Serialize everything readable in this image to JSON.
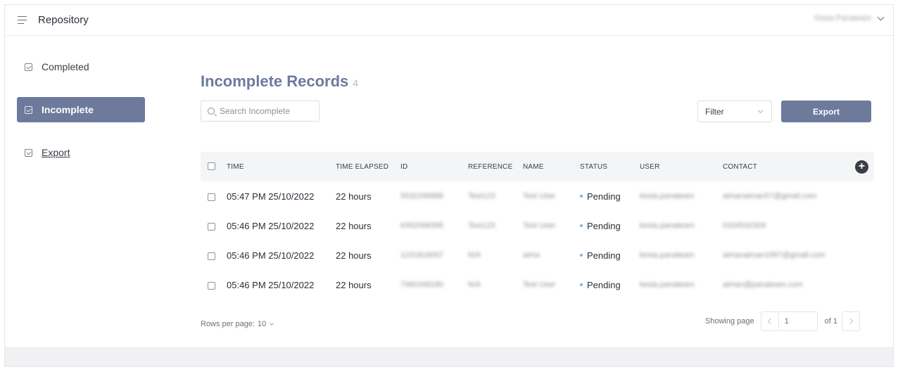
{
  "topbar": {
    "title": "Repository",
    "user_name": "Kesia Panateam"
  },
  "sidebar": {
    "items": [
      {
        "label": "Completed"
      },
      {
        "label": "Incomplete"
      },
      {
        "label": "Export"
      }
    ]
  },
  "main": {
    "title": "Incomplete Records",
    "count": "4",
    "search_placeholder": "Search Incomplete",
    "filter_label": "Filter",
    "export_label": "Export"
  },
  "table": {
    "headers": [
      "TIME",
      "TIME ELAPSED",
      "ID",
      "REFERENCE",
      "NAME",
      "STATUS",
      "USER",
      "CONTACT"
    ],
    "rows": [
      {
        "time": "05:47 PM 25/10/2022",
        "elapsed": "22 hours",
        "id": "5532298886",
        "reference": "Test123",
        "name": "Test User",
        "status": "Pending",
        "user": "kesia.panateam",
        "contact": "aimanaiman57@gmail.com"
      },
      {
        "time": "05:46 PM 25/10/2022",
        "elapsed": "22 hours",
        "id": "6392068395",
        "reference": "Test123",
        "name": "Test User",
        "status": "Pending",
        "user": "kesia.panateam",
        "contact": "0334532309"
      },
      {
        "time": "05:46 PM 25/10/2022",
        "elapsed": "22 hours",
        "id": "1231818057",
        "reference": "N/A",
        "name": "aima",
        "status": "Pending",
        "user": "kesia.panateam",
        "contact": "aimanaiman1997@gmail.com"
      },
      {
        "time": "05:46 PM 25/10/2022",
        "elapsed": "22 hours",
        "id": "7460348180",
        "reference": "N/A",
        "name": "Test User",
        "status": "Pending",
        "user": "kesia.panateam",
        "contact": "aiman@panateam.com"
      }
    ]
  },
  "pagination": {
    "rows_per_page_label": "Rows per page:",
    "rows_per_page_value": "10",
    "showing_label": "Showing page",
    "current_page": "1",
    "of_label": "of 1"
  },
  "colors": {
    "accent": "#6d7a9c",
    "status_dot": "#7db3e0"
  }
}
